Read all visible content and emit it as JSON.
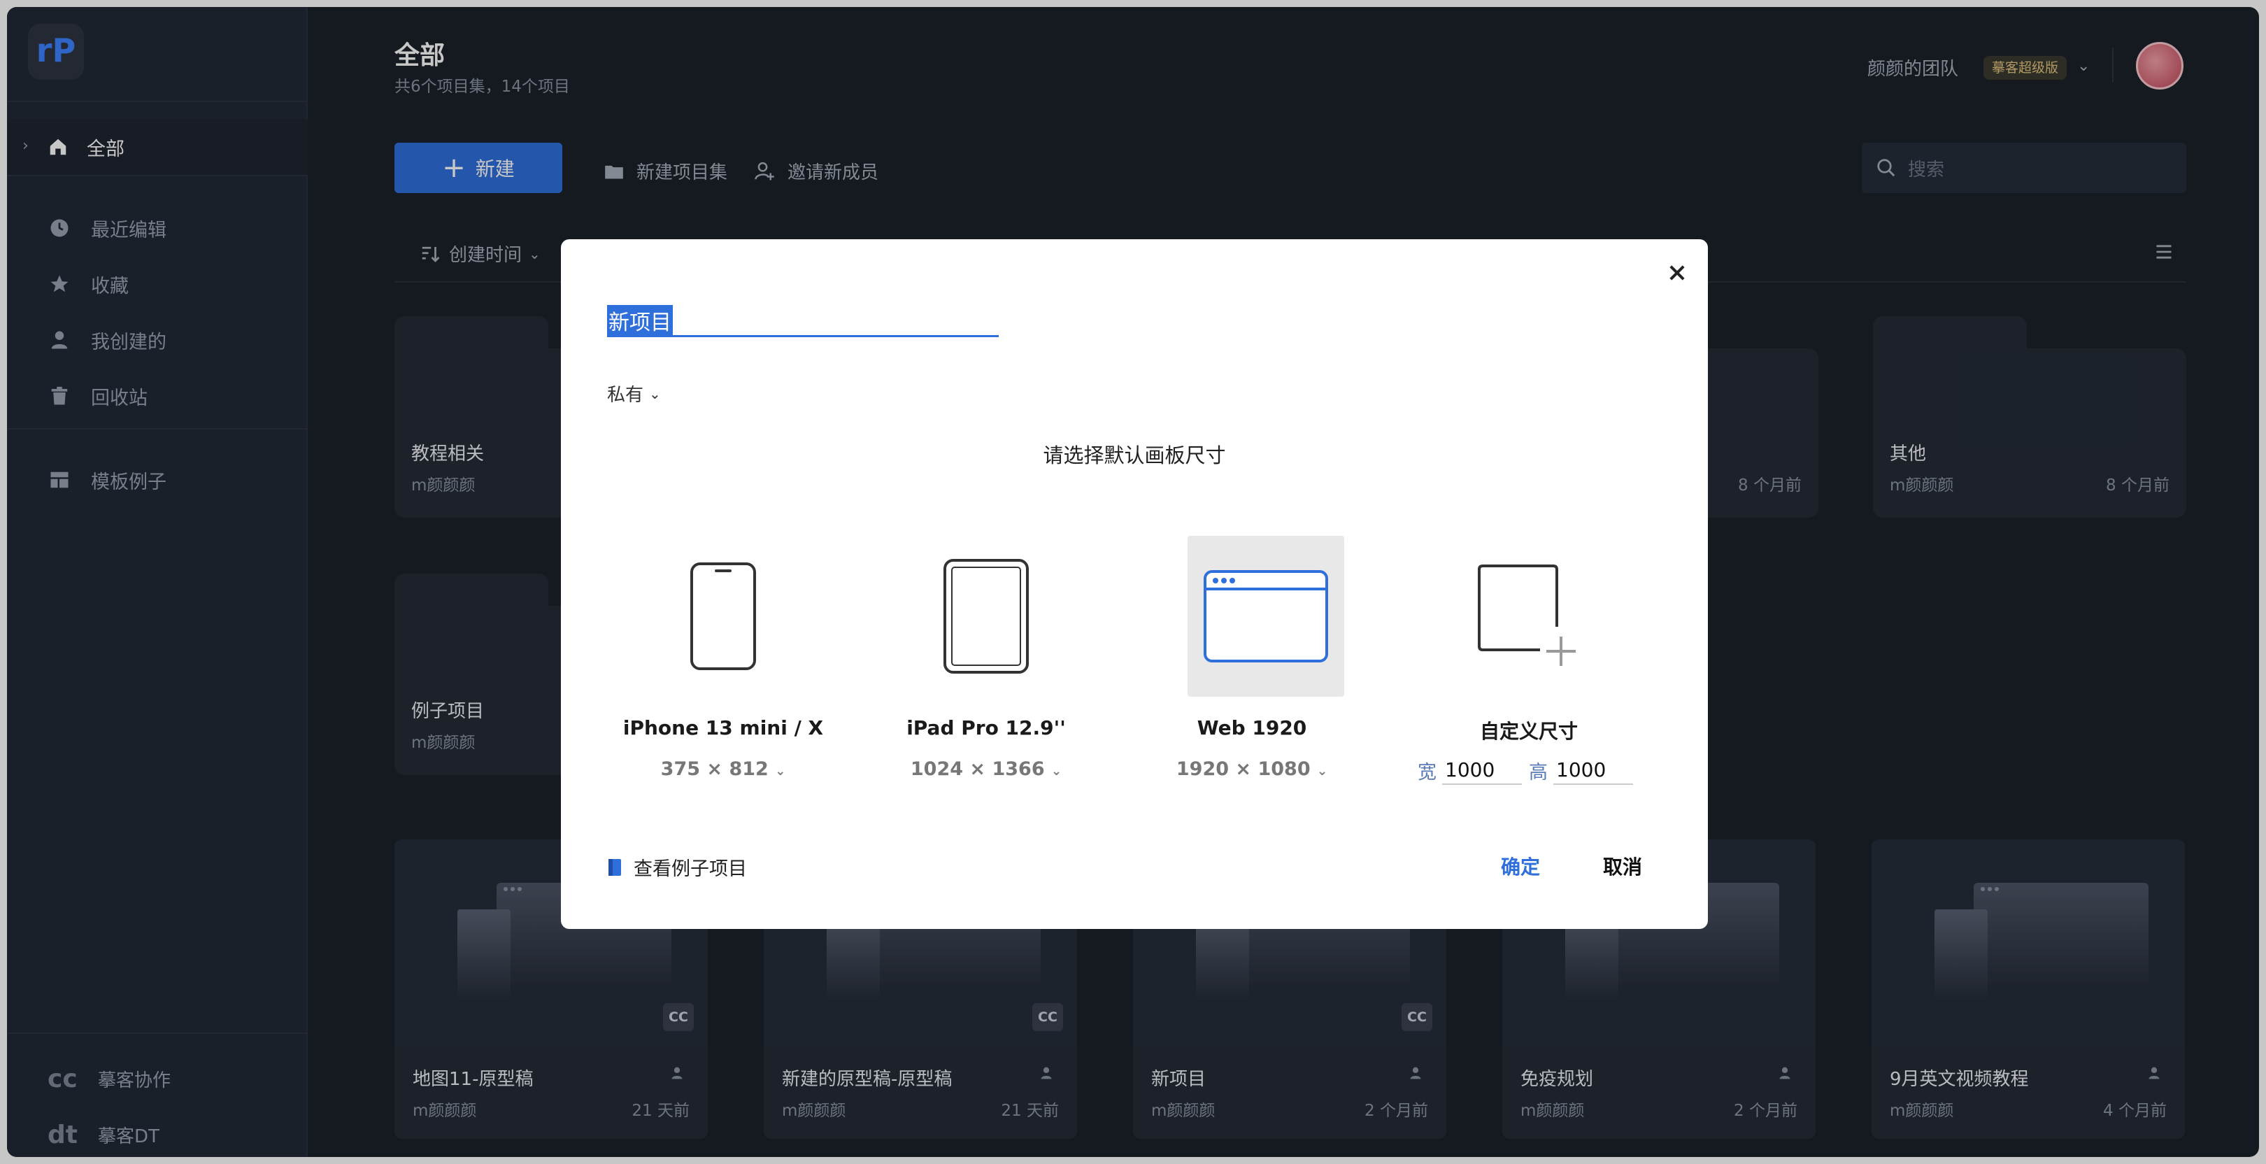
{
  "sidebar": {
    "logo": {
      "r": "r",
      "p": "P"
    },
    "items": [
      {
        "label": "全部",
        "icon": "home-icon"
      },
      {
        "label": "最近编辑",
        "icon": "clock-icon"
      },
      {
        "label": "收藏",
        "icon": "star-icon"
      },
      {
        "label": "我创建的",
        "icon": "user-icon"
      },
      {
        "label": "回收站",
        "icon": "trash-icon"
      },
      {
        "label": "模板例子",
        "icon": "template-icon"
      }
    ],
    "bottom": [
      {
        "badge": "cc",
        "label": "摹客协作"
      },
      {
        "badge": "dt",
        "label": "摹客DT"
      }
    ]
  },
  "header": {
    "title": "全部",
    "subtitle": "共6个项目集，14个项目",
    "team_name": "颜颜的团队",
    "team_badge": "摹客超级版"
  },
  "toolbar": {
    "new_label": "新建",
    "new_set_label": "新建项目集",
    "invite_label": "邀请新成员",
    "search_placeholder": "搜索",
    "sort_label": "创建时间"
  },
  "folders": [
    {
      "name": "教程相关",
      "owner": "m颜颜颜",
      "time": ""
    },
    {
      "name": "",
      "owner": "",
      "time": "8 个月前"
    },
    {
      "name": "其他",
      "owner": "m颜颜颜",
      "time": "8 个月前"
    },
    {
      "name": "例子项目",
      "owner": "m颜颜颜",
      "time": ""
    }
  ],
  "projects": [
    {
      "name": "地图11-原型稿",
      "owner": "m颜颜颜",
      "time": "21 天前",
      "cc": "CC"
    },
    {
      "name": "新建的原型稿-原型稿",
      "owner": "m颜颜颜",
      "time": "21 天前",
      "cc": "CC"
    },
    {
      "name": "新项目",
      "owner": "m颜颜颜",
      "time": "2 个月前",
      "cc": "CC"
    },
    {
      "name": "免疫规划",
      "owner": "m颜颜颜",
      "time": "2 个月前",
      "cc": ""
    },
    {
      "name": "9月英文视频教程",
      "owner": "m颜颜颜",
      "time": "4 个月前",
      "cc": ""
    }
  ],
  "modal": {
    "name_value": "新项目",
    "privacy": "私有",
    "heading": "请选择默认画板尺寸",
    "options": [
      {
        "label": "iPhone 13 mini / X",
        "size": "375 × 812"
      },
      {
        "label": "iPad Pro 12.9''",
        "size": "1024 × 1366"
      },
      {
        "label": "Web 1920",
        "size": "1920 × 1080"
      },
      {
        "label": "自定义尺寸",
        "width_label": "宽",
        "width": "1000",
        "height_label": "高",
        "height": "1000"
      }
    ],
    "example_link": "查看例子项目",
    "confirm": "确定",
    "cancel": "取消"
  },
  "colors": {
    "accent": "#2f6fdb",
    "background": "#1b2029",
    "sidebar": "#222935"
  }
}
